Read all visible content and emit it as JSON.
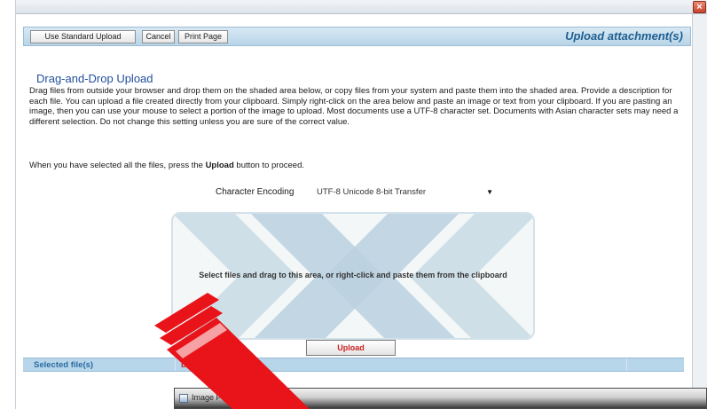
{
  "window": {
    "close_symbol": "×"
  },
  "toolbar": {
    "standard_upload_label": "Use Standard Upload",
    "cancel_label": "Cancel",
    "print_label": "Print Page",
    "title": "Upload attachment(s)"
  },
  "main": {
    "heading": "Drag-and-Drop Upload",
    "description": "Drag files from outside your browser and drop them on the shaded area below, or copy files from your system and paste them into the shaded area. Provide a description for each file. You can upload a file created directly from your clipboard. Simply right-click on the area below and paste an image or text from your clipboard. If you are pasting an image, then you can use your mouse to select a portion of the image to upload. Most documents use a UTF-8 character set. Documents with Asian character sets may need a different selection. Do not change this setting unless you are sure of the correct value.",
    "proceed_prefix": "When you have selected all the files, press the ",
    "proceed_bold": "Upload",
    "proceed_suffix": " button to proceed."
  },
  "encoding": {
    "label": "Character Encoding",
    "selected": "UTF-8 Unicode 8-bit Transfer"
  },
  "dropzone": {
    "text": "Select files and drag to this area, or right-click and paste them from the clipboard"
  },
  "upload_button": {
    "label": "Upload"
  },
  "files_table": {
    "col_selected": "Selected file(s)",
    "col_desc": "Des"
  },
  "popup": {
    "title": "Image P"
  },
  "colors": {
    "accent": "#1f5e90",
    "header_bar": "#b7d6ea",
    "red_annotation": "#e8141a"
  }
}
